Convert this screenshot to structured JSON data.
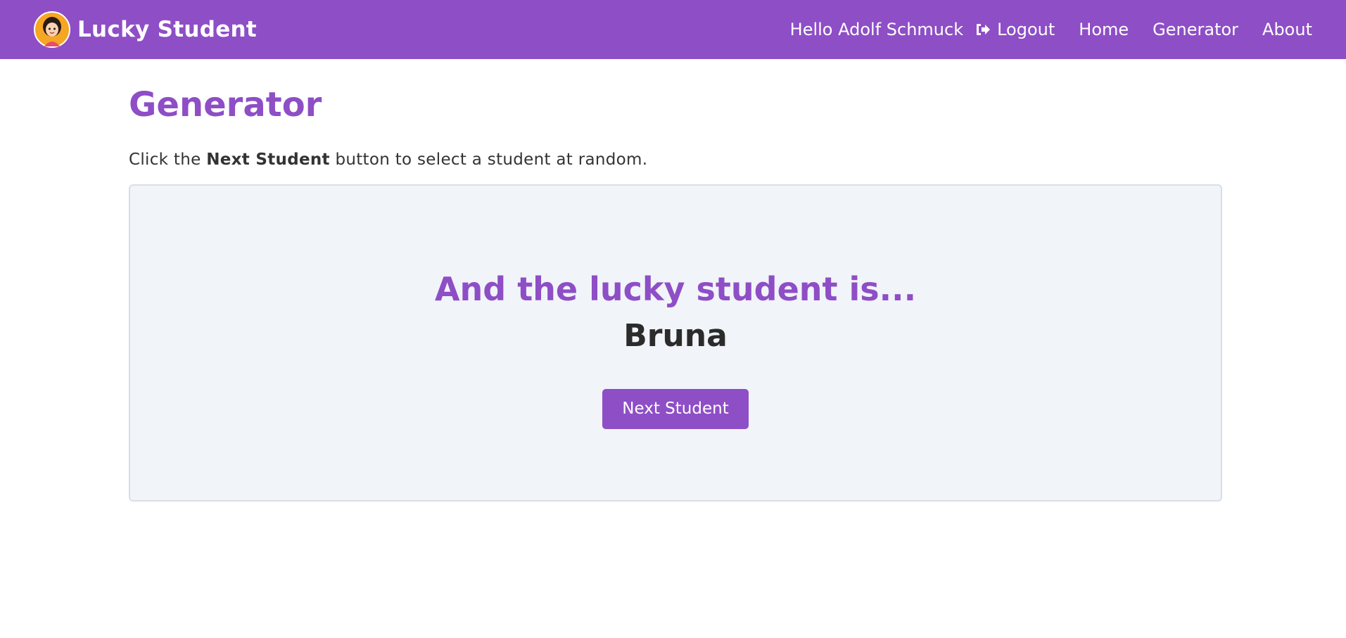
{
  "navbar": {
    "brand": "Lucky Student",
    "greeting": "Hello Adolf Schmuck",
    "logout": "Logout",
    "links": [
      "Home",
      "Generator",
      "About"
    ]
  },
  "main": {
    "title": "Generator",
    "intro_prefix": "Click the ",
    "intro_bold": "Next Student",
    "intro_suffix": " button to select a student at random.",
    "panel_heading": "And the lucky student is...",
    "student_name": "Bruna",
    "button_label": "Next Student"
  },
  "colors": {
    "brand_purple": "#8e4ec6",
    "panel_bg": "#f1f4f8",
    "text_dark": "#333333"
  },
  "icons": {
    "logo": "girl-avatar-logo",
    "logout": "sign-out-icon"
  }
}
